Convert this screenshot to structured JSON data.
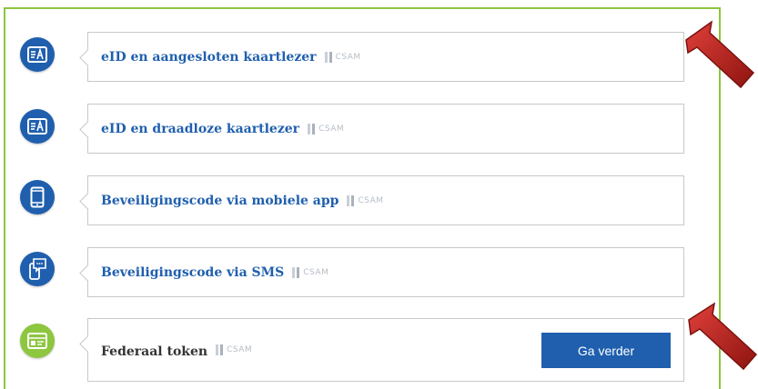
{
  "options": [
    {
      "label": "eID en aangesloten kaartlezer",
      "badge": "CSAM",
      "icon": "id-card-reader-icon"
    },
    {
      "label": "eID en draadloze kaartlezer",
      "badge": "CSAM",
      "icon": "id-card-wireless-icon"
    },
    {
      "label": "Beveiligingscode via mobiele app",
      "badge": "CSAM",
      "icon": "mobile-phone-icon"
    },
    {
      "label": "Beveiligingscode via SMS",
      "badge": "CSAM",
      "icon": "sms-icon"
    },
    {
      "label": "Federaal token",
      "badge": "CSAM",
      "icon": "token-card-icon",
      "button": "Ga verder"
    }
  ],
  "colors": {
    "accent_blue": "#1f5fae",
    "frame_green": "#8dc63f",
    "arrow_red": "#c0201c"
  }
}
